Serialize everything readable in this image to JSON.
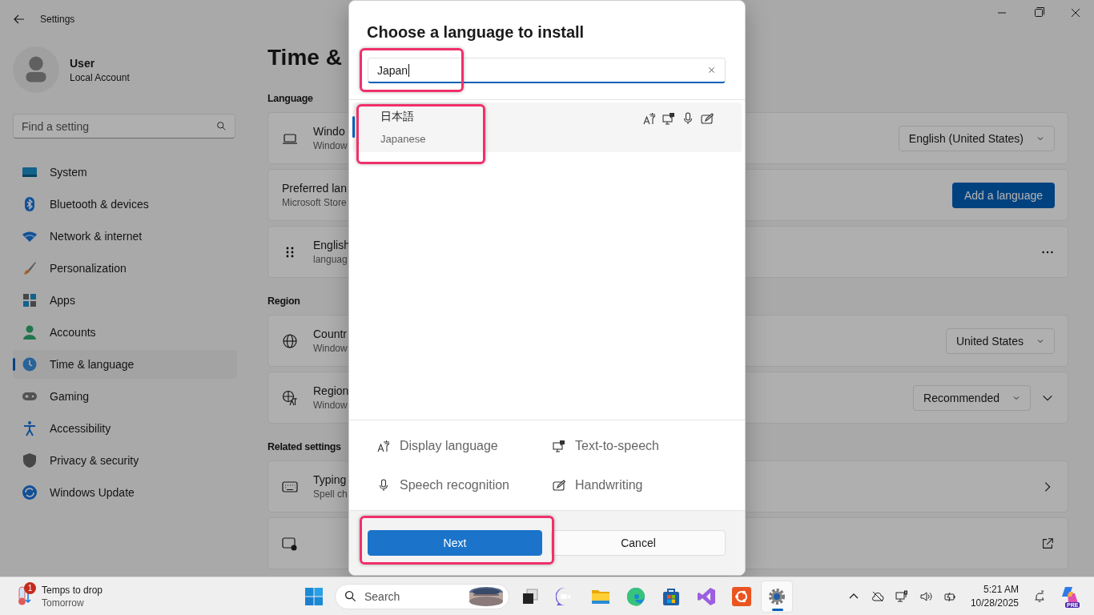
{
  "settings_window": {
    "title": "Settings",
    "user": {
      "name": "User",
      "account": "Local Account"
    },
    "search": {
      "placeholder": "Find a setting"
    },
    "nav": [
      {
        "label": "System",
        "kind": "system",
        "selected": false
      },
      {
        "label": "Bluetooth & devices",
        "kind": "bluetooth",
        "selected": false
      },
      {
        "label": "Network & internet",
        "kind": "network",
        "selected": false
      },
      {
        "label": "Personalization",
        "kind": "personalization",
        "selected": false
      },
      {
        "label": "Apps",
        "kind": "apps",
        "selected": false
      },
      {
        "label": "Accounts",
        "kind": "accounts",
        "selected": false
      },
      {
        "label": "Time & language",
        "kind": "time",
        "selected": true
      },
      {
        "label": "Gaming",
        "kind": "gaming",
        "selected": false
      },
      {
        "label": "Accessibility",
        "kind": "accessibility",
        "selected": false
      },
      {
        "label": "Privacy & security",
        "kind": "privacy",
        "selected": false
      },
      {
        "label": "Windows Update",
        "kind": "update",
        "selected": false
      }
    ],
    "page_title": "Time &",
    "sections": [
      {
        "heading": "Language",
        "cards": [
          {
            "kind": "laptop",
            "title": "Windo",
            "subtitle": "Window",
            "controls": [
              {
                "kind": "dropdown",
                "label": "English (United States)"
              }
            ]
          },
          {
            "kind": "plain",
            "title": "Preferred lan",
            "subtitle": "Microsoft Store",
            "controls": [
              {
                "kind": "primary",
                "label": "Add a language"
              }
            ]
          },
          {
            "kind": "handle",
            "title": "English",
            "subtitle": "languag",
            "controls": [
              {
                "kind": "more"
              }
            ]
          }
        ]
      },
      {
        "heading": "Region",
        "cards": [
          {
            "kind": "globe",
            "title": "Countr",
            "subtitle": "Window",
            "controls": [
              {
                "kind": "dropdown",
                "label": "United States"
              }
            ]
          },
          {
            "kind": "region",
            "title": "Region",
            "subtitle": "Window",
            "controls": [
              {
                "kind": "dropdown",
                "label": "Recommended"
              },
              {
                "kind": "expand"
              }
            ]
          }
        ]
      },
      {
        "heading": "Related settings",
        "cards": [
          {
            "kind": "keyboard",
            "title": "Typing",
            "subtitle": "Spell ch",
            "controls": [
              {
                "kind": "chevron"
              }
            ]
          },
          {
            "kind": "admin",
            "controls": [
              {
                "kind": "external"
              }
            ]
          }
        ]
      }
    ]
  },
  "dialog": {
    "title": "Choose a language to install",
    "search": {
      "value": "Japan",
      "highlighted": true
    },
    "results": [
      {
        "native": "日本語",
        "english": "Japanese",
        "selected": true,
        "highlighted": true,
        "features": [
          {
            "kind": "display"
          },
          {
            "kind": "tts"
          },
          {
            "kind": "speech"
          },
          {
            "kind": "handwriting"
          }
        ]
      }
    ],
    "legend": [
      {
        "kind": "display",
        "label": "Display language"
      },
      {
        "kind": "tts",
        "label": "Text-to-speech"
      },
      {
        "kind": "speech",
        "label": "Speech recognition"
      },
      {
        "kind": "handwriting",
        "label": "Handwriting"
      }
    ],
    "buttons": [
      {
        "kind": "primary",
        "label": "Next",
        "highlighted": true
      },
      {
        "kind": "secondary",
        "label": "Cancel",
        "highlighted": false
      }
    ]
  },
  "taskbar": {
    "weather": {
      "badge": "1",
      "title": "Temps to drop",
      "subtitle": "Tomorrow"
    },
    "search": {
      "placeholder": "Search"
    },
    "apps": [
      {
        "kind": "taskview",
        "active": false
      },
      {
        "kind": "meet",
        "active": false
      },
      {
        "kind": "folder",
        "active": false
      },
      {
        "kind": "edge",
        "active": false
      },
      {
        "kind": "store",
        "active": false
      },
      {
        "kind": "studio",
        "active": false
      },
      {
        "kind": "ubuntu",
        "active": false
      },
      {
        "kind": "settings",
        "active": true
      }
    ],
    "time": "5:21 AM",
    "date": "10/28/2025",
    "copilot_badge": "PRE"
  }
}
